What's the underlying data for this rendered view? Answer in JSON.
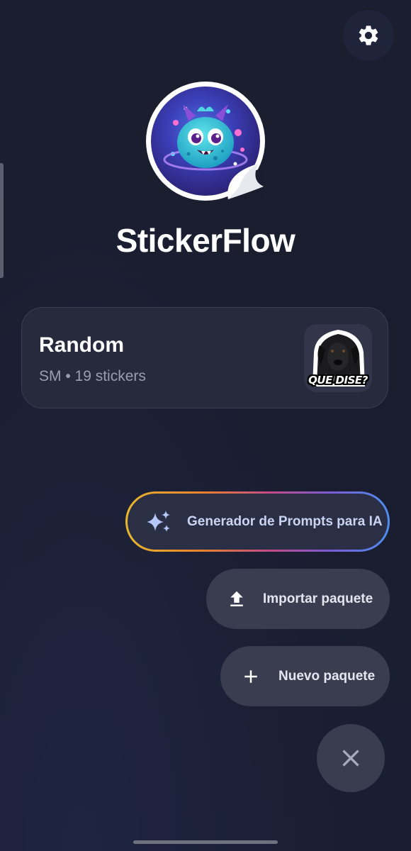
{
  "app": {
    "title": "StickerFlow"
  },
  "pack": {
    "name": "Random",
    "meta": "SM • 19 stickers",
    "thumbnail_caption": "QUE DISE?"
  },
  "actions": {
    "ai_prompt_label": "Generador de Prompts para IA",
    "import_label": "Importar paquete",
    "new_label": "Nuevo paquete"
  },
  "icons": {
    "settings": "gear-icon",
    "ai": "sparkles-icon",
    "import": "upload-icon",
    "new": "plus-icon",
    "close": "close-icon"
  },
  "colors": {
    "background": "#1b1e2f",
    "card": "#272a3c",
    "fab": "#3a3d50",
    "ai_text": "#c9d4f3",
    "ai_border_gradient": [
      "#e8b72d",
      "#e8802d",
      "#c24a8a",
      "#7a5cd6",
      "#4d8ef0"
    ]
  }
}
